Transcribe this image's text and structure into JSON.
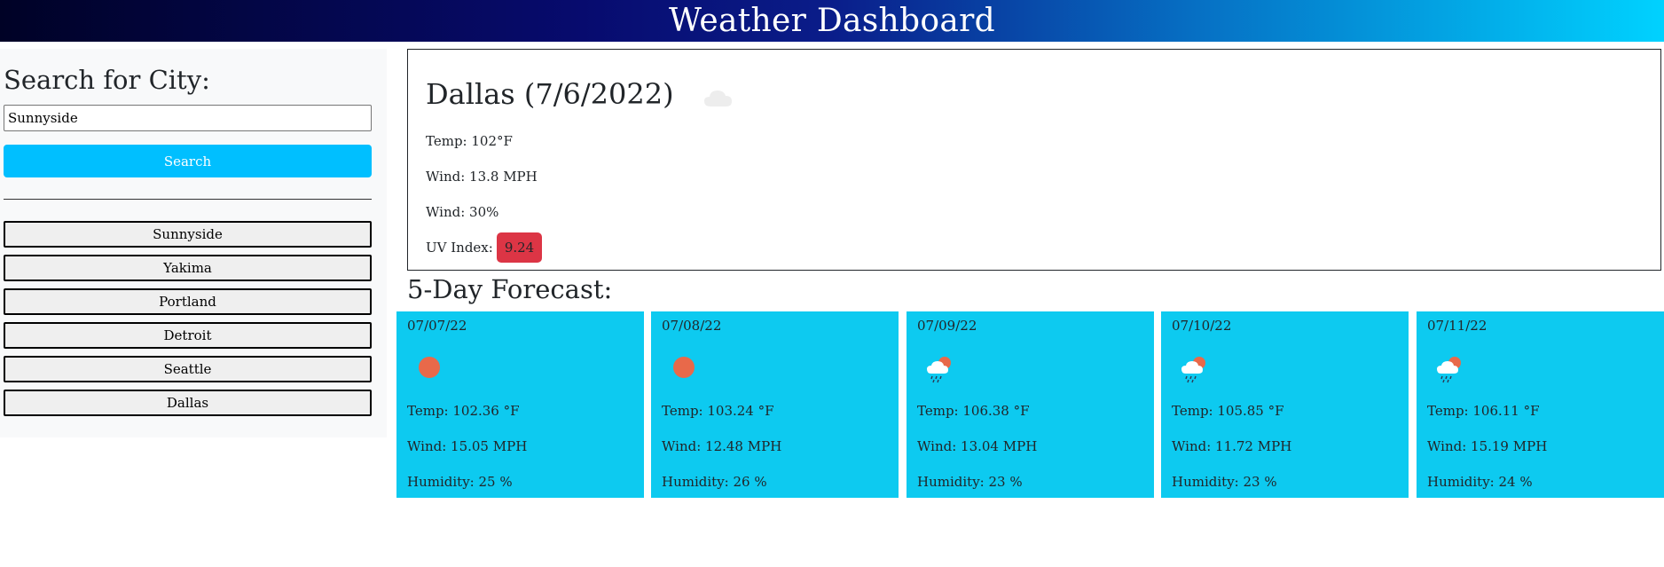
{
  "header": {
    "title": "Weather Dashboard"
  },
  "sidebar": {
    "heading": "Search for City:",
    "search_value": "Sunnyside",
    "search_button": "Search",
    "history": [
      "Sunnyside",
      "Yakima",
      "Portland",
      "Detroit",
      "Seattle",
      "Dallas"
    ]
  },
  "current": {
    "title": "Dallas (7/6/2022)",
    "icon": "cloud-icon",
    "temp": "Temp: 102°F",
    "wind": "Wind: 13.8 MPH",
    "humidity": "Wind: 30%",
    "uv_label": "UV Index:",
    "uv_value": "9.24",
    "uv_color": "#dc3545"
  },
  "forecast": {
    "heading": "5-Day Forecast:",
    "days": [
      {
        "date": "07/07/22",
        "icon": "sun-icon",
        "temp": "Temp: 102.36 °F",
        "wind": "Wind: 15.05 MPH",
        "humidity": "Humidity: 25 %"
      },
      {
        "date": "07/08/22",
        "icon": "sun-icon",
        "temp": "Temp: 103.24 °F",
        "wind": "Wind: 12.48 MPH",
        "humidity": "Humidity: 26 %"
      },
      {
        "date": "07/09/22",
        "icon": "sun-rain-cloud-icon",
        "temp": "Temp: 106.38 °F",
        "wind": "Wind: 13.04 MPH",
        "humidity": "Humidity: 23 %"
      },
      {
        "date": "07/10/22",
        "icon": "sun-rain-cloud-icon",
        "temp": "Temp: 105.85 °F",
        "wind": "Wind: 11.72 MPH",
        "humidity": "Humidity: 23 %"
      },
      {
        "date": "07/11/22",
        "icon": "sun-rain-cloud-icon",
        "temp": "Temp: 106.11 °F",
        "wind": "Wind: 15.19 MPH",
        "humidity": "Humidity: 24 %"
      }
    ]
  },
  "colors": {
    "accent": "#00bfff",
    "card_bg": "#0dcaf0",
    "sidebar_bg": "#f8f9fa"
  }
}
